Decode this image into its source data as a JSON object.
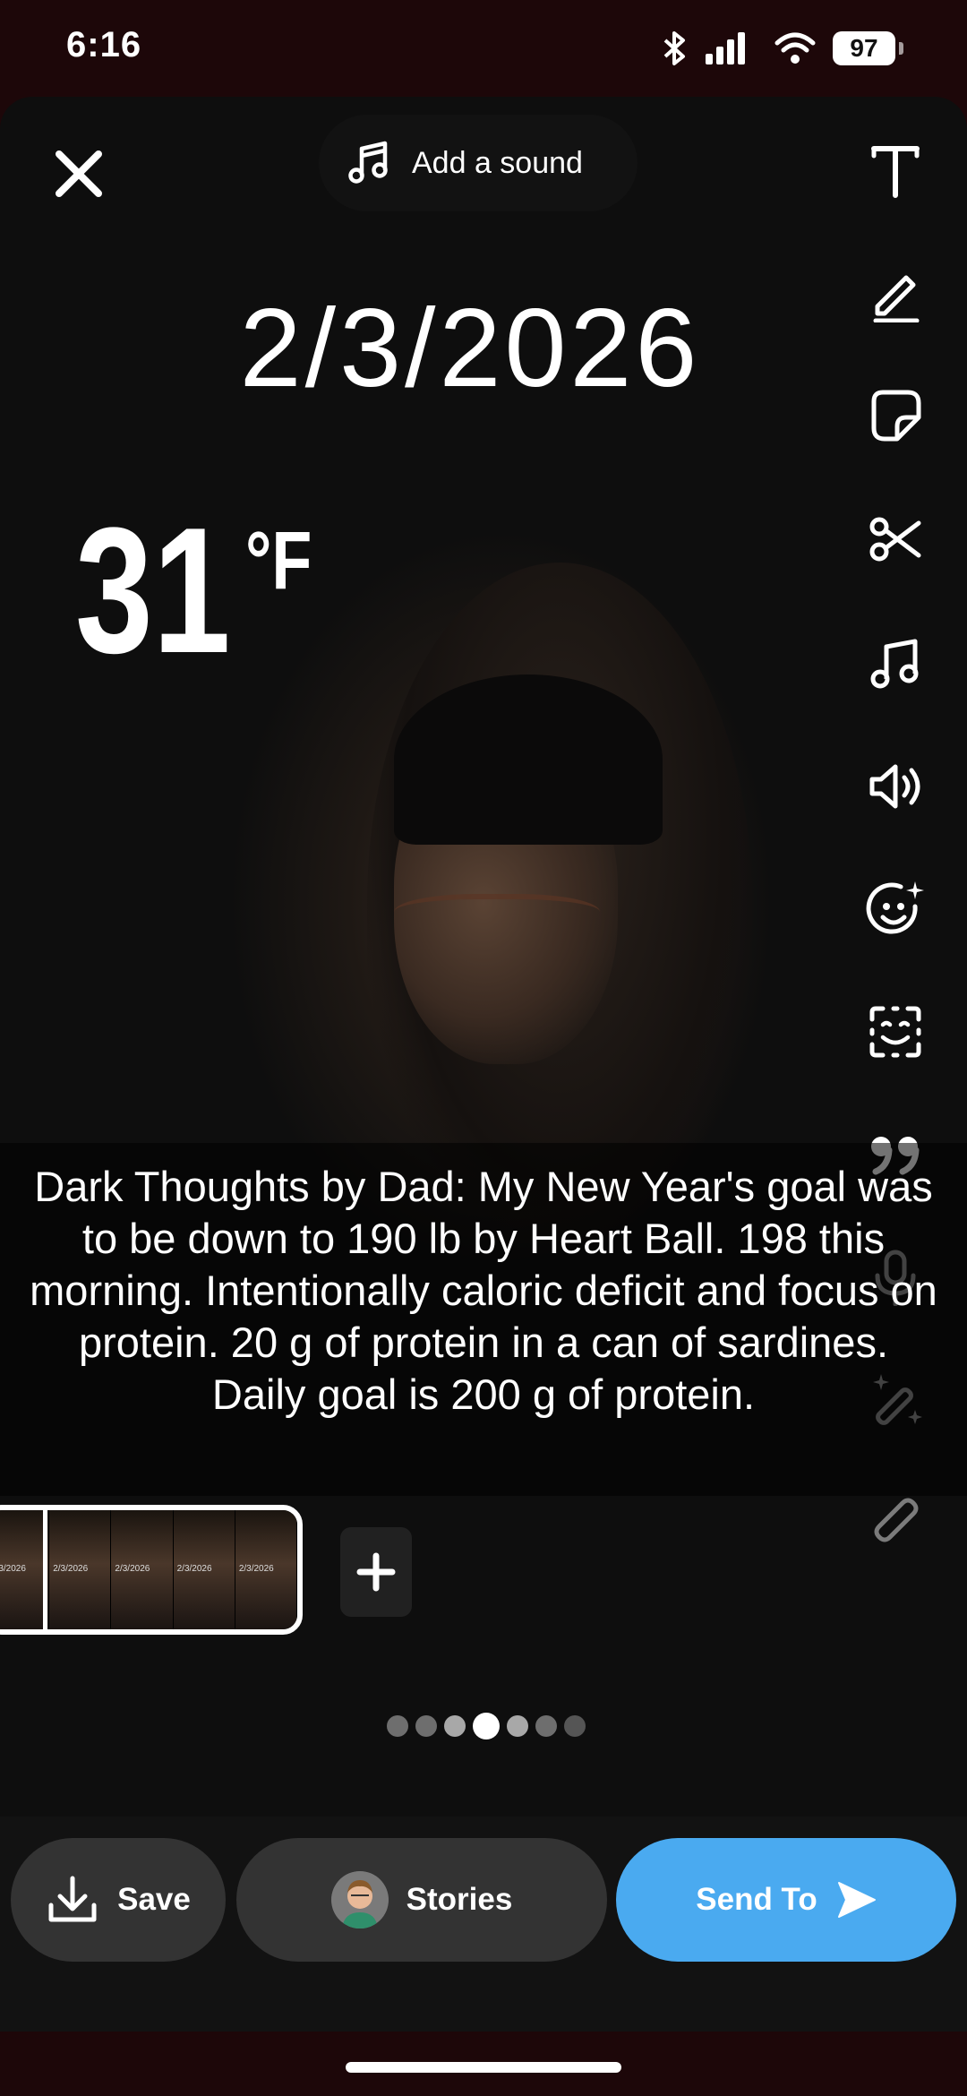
{
  "status_bar": {
    "time": "6:16",
    "battery": "97"
  },
  "top": {
    "sound_label": "Add a sound"
  },
  "stickers": {
    "date": "2/3/2026",
    "temperature": "31",
    "temperature_unit": "°F"
  },
  "tools": [
    "text-icon",
    "pen-icon",
    "sticker-icon",
    "scissors-icon",
    "music-icon",
    "speaker-icon",
    "emoji-icon",
    "lens-icon",
    "quote-icon",
    "microphone-icon",
    "magic-wand-icon",
    "paperclip-icon"
  ],
  "caption": "Dark Thoughts by Dad: My New Year's goal was to be down to 190 lb by Heart Ball.  198 this morning.  Intentionally caloric deficit and focus on protein. 20 g of protein in a can of sardines.  Daily goal is 200 g of protein.",
  "timeline": {
    "thumb_label": "2/3/2026"
  },
  "pagination": {
    "total": 7,
    "active": 4
  },
  "bottom": {
    "save": "Save",
    "stories": "Stories",
    "send": "Send To"
  },
  "colors": {
    "accent": "#4aaaf0",
    "button_bg": "#333333",
    "status_bg": "#1d0709"
  }
}
